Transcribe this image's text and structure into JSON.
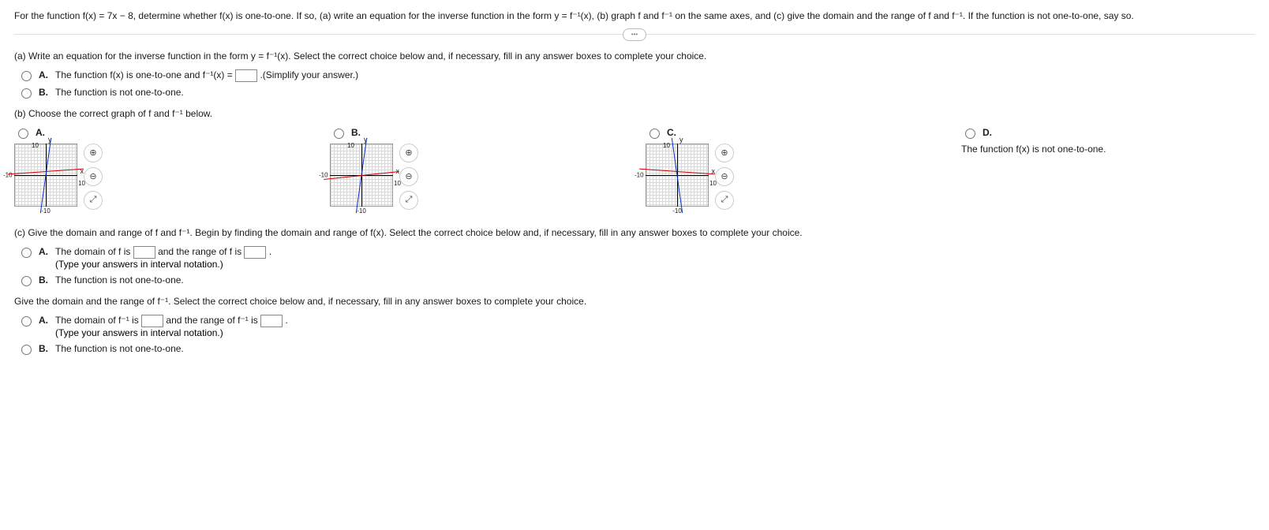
{
  "problem": "For the function f(x) = 7x − 8, determine whether f(x) is one-to-one. If so, (a) write an equation for the inverse function in the form y = f⁻¹(x), (b) graph f and f⁻¹ on the same axes, and (c) give the domain and the range of f and f⁻¹. If the function is not one-to-one, say so.",
  "divider_label": "•••",
  "part_a": {
    "prompt": "(a) Write an equation for the inverse function in the form y = f⁻¹(x). Select the correct choice below and, if necessary, fill in any answer boxes to complete your choice.",
    "A_label": "A.",
    "A_text1": "The function f(x) is one-to-one and f⁻¹(x) = ",
    "A_text2": ".(Simplify your answer.)",
    "B_label": "B.",
    "B_text": "The function is not one-to-one."
  },
  "part_b": {
    "prompt": "(b) Choose the correct graph of f and f⁻¹ below.",
    "choices": [
      "A.",
      "B.",
      "C.",
      "D."
    ],
    "axis_y": "y",
    "axis_x": "x",
    "tick_neg": "-10",
    "tick_pos": "10",
    "tick_top": "10",
    "tick_bot": "-10",
    "D_text": "The function f(x) is not one-to-one."
  },
  "part_c": {
    "prompt1": "(c) Give the domain and range of f and f⁻¹. Begin by finding the domain and range of f(x). Select the correct choice below and, if necessary, fill in any answer boxes to complete your choice.",
    "c1_A_label": "A.",
    "c1_A_t1": "The domain of f is ",
    "c1_A_t2": " and the range of f is ",
    "c1_A_t3": ".",
    "interval_note": "(Type your answers in interval notation.)",
    "c1_B_label": "B.",
    "c1_B_text": "The function is not one-to-one.",
    "prompt2": "Give the domain and the range of f⁻¹. Select the correct choice below and, if necessary, fill in any answer boxes to complete your choice.",
    "c2_A_label": "A.",
    "c2_A_t1": "The domain of f⁻¹ is ",
    "c2_A_t2": " and the range of f⁻¹ is ",
    "c2_A_t3": ".",
    "c2_B_label": "B.",
    "c2_B_text": "The function is not one-to-one."
  },
  "icons": {
    "zoom_in": "⊕",
    "zoom_out": "⊖",
    "expand": "⤢"
  }
}
